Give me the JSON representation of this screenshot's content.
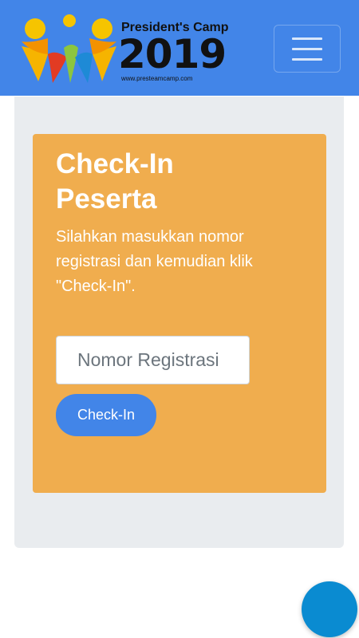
{
  "header": {
    "logo": {
      "title": "President's Camp",
      "year": "2019",
      "url": "www.presteamcamp.com"
    },
    "menu_icon": "hamburger-menu-icon"
  },
  "checkin": {
    "title": "Check-In Peserta",
    "description": "Silahkan masukkan nomor registrasi dan kemudian klik \"Check-In\".",
    "input_placeholder": "Nomor Registrasi",
    "input_value": "",
    "button_label": "Check-In"
  },
  "colors": {
    "navbar": "#4285e8",
    "card": "#f0ad4e",
    "panel": "#e9ecef",
    "button": "#4285e8",
    "fab": "#0a8bd1"
  },
  "fab_icon": "floating-action-button"
}
